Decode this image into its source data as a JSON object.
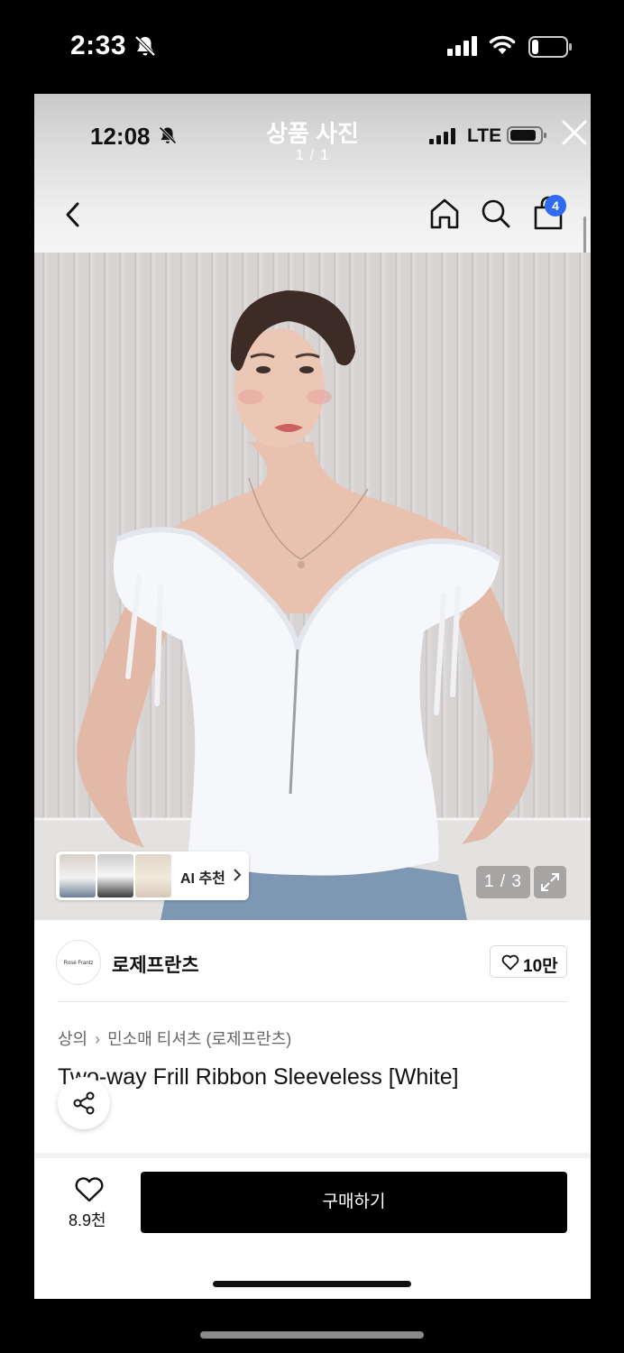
{
  "outer_status": {
    "time": "2:33",
    "icons": [
      "bell-slash-icon",
      "signal-icon",
      "wifi-icon",
      "battery-icon"
    ]
  },
  "inner_status": {
    "time": "12:08",
    "network": "LTE"
  },
  "viewer": {
    "title": "상품 사진",
    "count": "1 / 1"
  },
  "nav": {
    "cart_badge": "4",
    "icons": [
      "back-icon",
      "home-icon",
      "search-icon",
      "cart-icon"
    ]
  },
  "gallery": {
    "ai_label": "AI 추천",
    "page_indicator": "1 / 3"
  },
  "brand": {
    "name": "로제프란츠",
    "logo_text": "Rosé Frantz",
    "likes": "10만"
  },
  "breadcrumb": [
    "상의",
    "민소매 티셔츠 (로제프란츠)"
  ],
  "product": {
    "title": "Two-way Frill Ribbon Sleeveless [White]"
  },
  "bottom_bar": {
    "wish_count": "8.9천",
    "buy_label": "구매하기"
  },
  "colors": {
    "accent_badge": "#2f6bf0",
    "buy_button": "#000000",
    "background": "#ffffff"
  }
}
